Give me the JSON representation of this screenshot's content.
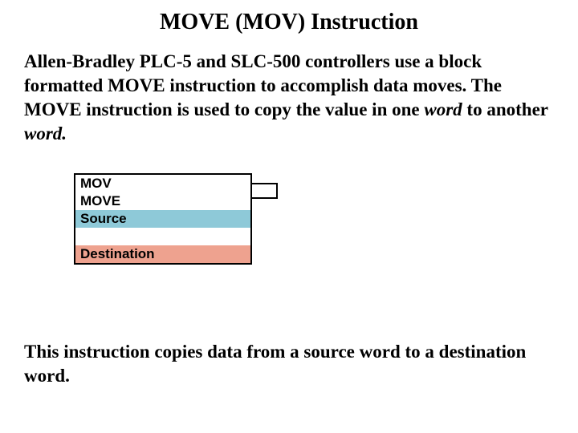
{
  "title": "MOVE (MOV) Instruction",
  "p1_a": "Allen-Bradley PLC-5 and SLC-500 controllers use a block formatted MOVE instruction to accomplish data moves. The MOVE instruction is used to copy the value in one ",
  "p1_w1": "word",
  "p1_b": " to another ",
  "p1_w2": "word.",
  "block": {
    "r1": "MOV",
    "r2": "MOVE",
    "r3": "Source",
    "r4": "",
    "r5": "Destination"
  },
  "p2": "This instruction copies data from a source word to a destination word."
}
